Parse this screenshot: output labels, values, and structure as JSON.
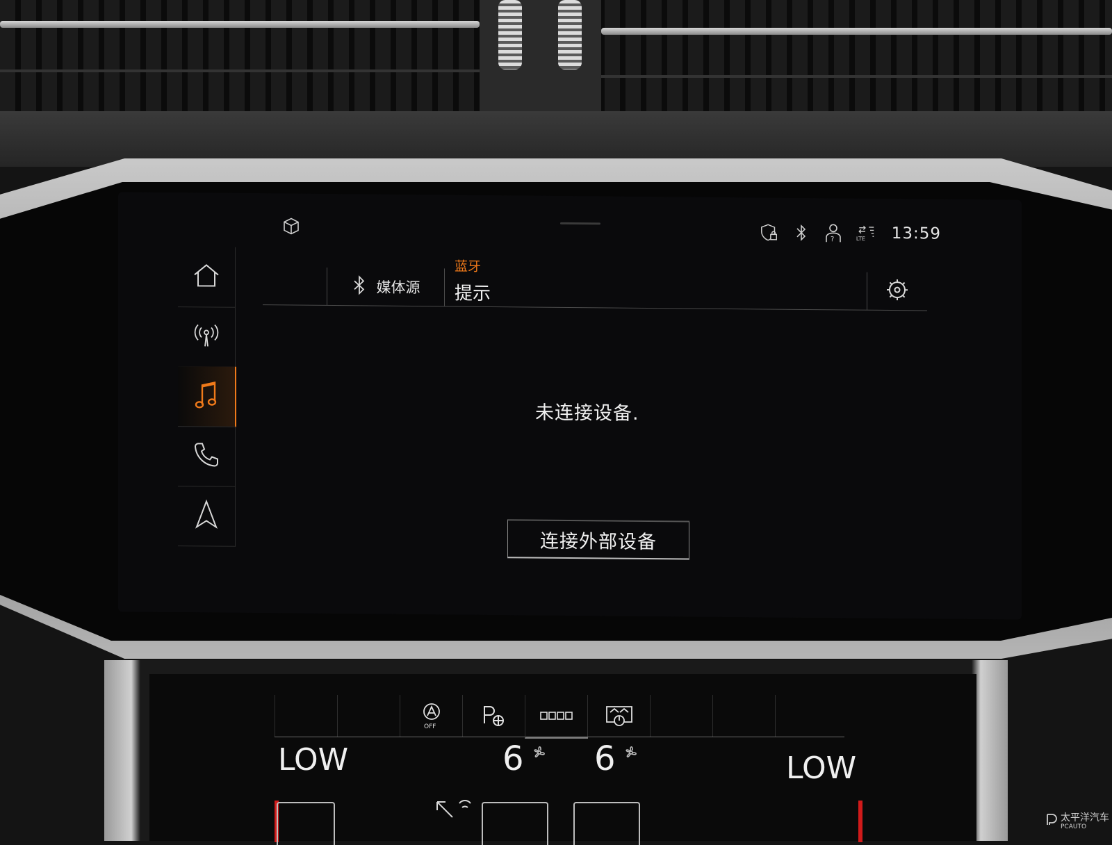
{
  "status_bar": {
    "time": "13:59",
    "icons": [
      "cube-icon",
      "shield-lock-icon",
      "bluetooth-icon",
      "user-help-icon",
      "lte-signal-icon"
    ],
    "lte_label": "LTE"
  },
  "sidebar": {
    "items": [
      {
        "icon": "home-icon",
        "active": false
      },
      {
        "icon": "radio-antenna-icon",
        "active": true
      },
      {
        "icon": "music-note-icon",
        "active": true
      },
      {
        "icon": "phone-icon",
        "active": false
      },
      {
        "icon": "navigation-icon",
        "active": false
      }
    ]
  },
  "header": {
    "source_label": "媒体源",
    "title_sub": "蓝牙",
    "title_main": "提示"
  },
  "main": {
    "message": "未连接设备.",
    "connect_button_label": "连接外部设备"
  },
  "climate": {
    "auto_off_label": "OFF",
    "left_temp": "LOW",
    "right_temp": "LOW",
    "left_fan": "6",
    "right_fan": "6"
  },
  "watermark": {
    "brand": "太平洋汽车",
    "sub": "PCAUTO"
  },
  "colors": {
    "accent": "#f07a1a",
    "text": "#f0f0f0",
    "screen_bg": "#0a0a0c"
  }
}
